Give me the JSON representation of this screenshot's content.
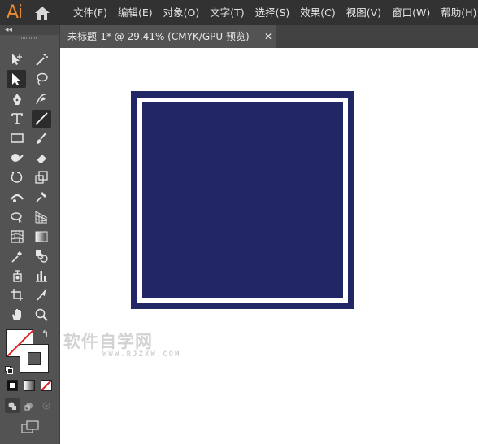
{
  "app": {
    "logo": "Ai"
  },
  "menu": [
    "文件(F)",
    "编辑(E)",
    "对象(O)",
    "文字(T)",
    "选择(S)",
    "效果(C)",
    "视图(V)",
    "窗口(W)",
    "帮助(H)"
  ],
  "document_tab": {
    "title": "未标题-1* @ 29.41% (CMYK/GPU 预览)",
    "close": "✕"
  },
  "toolbar": {
    "collapse": "◂◂"
  },
  "artwork": {
    "fill_color": "#212764",
    "frame_color": "#ffffff"
  },
  "watermark": {
    "line1": "软件自学网",
    "line2": "WWW.RJZXW.COM"
  }
}
